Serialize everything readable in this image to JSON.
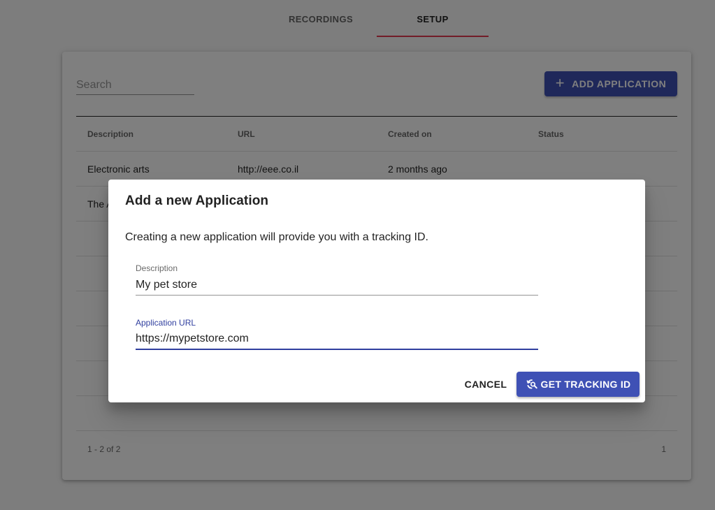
{
  "tabs": [
    {
      "label": "RECORDINGS",
      "active": false
    },
    {
      "label": "SETUP",
      "active": true
    }
  ],
  "colors": {
    "tab_indicator": "#e53950",
    "primary": "#3f51b5",
    "focus": "#303f9f"
  },
  "toolbar": {
    "search_placeholder": "Search",
    "add_button_label": "ADD APPLICATION",
    "add_button_icon": "plus-icon"
  },
  "table": {
    "columns": [
      "Description",
      "URL",
      "Created on",
      "Status"
    ],
    "rows": [
      {
        "description": "Electronic arts",
        "url": "http://eee.co.il",
        "created_on": "2 months ago",
        "status": ""
      },
      {
        "description": "The A",
        "url": "",
        "created_on": "",
        "status": ""
      }
    ],
    "pagination_text": "1 - 2 of 2",
    "page_number": "1"
  },
  "dialog": {
    "title": "Add a new Application",
    "text": "Creating a new application will provide you with a tracking ID.",
    "description_label": "Description",
    "description_value": "My pet store",
    "url_label": "Application URL",
    "url_value": "https://mypetstore.com",
    "cancel_label": "CANCEL",
    "submit_label": "GET TRACKING ID",
    "submit_icon": "refresh-search-icon"
  }
}
